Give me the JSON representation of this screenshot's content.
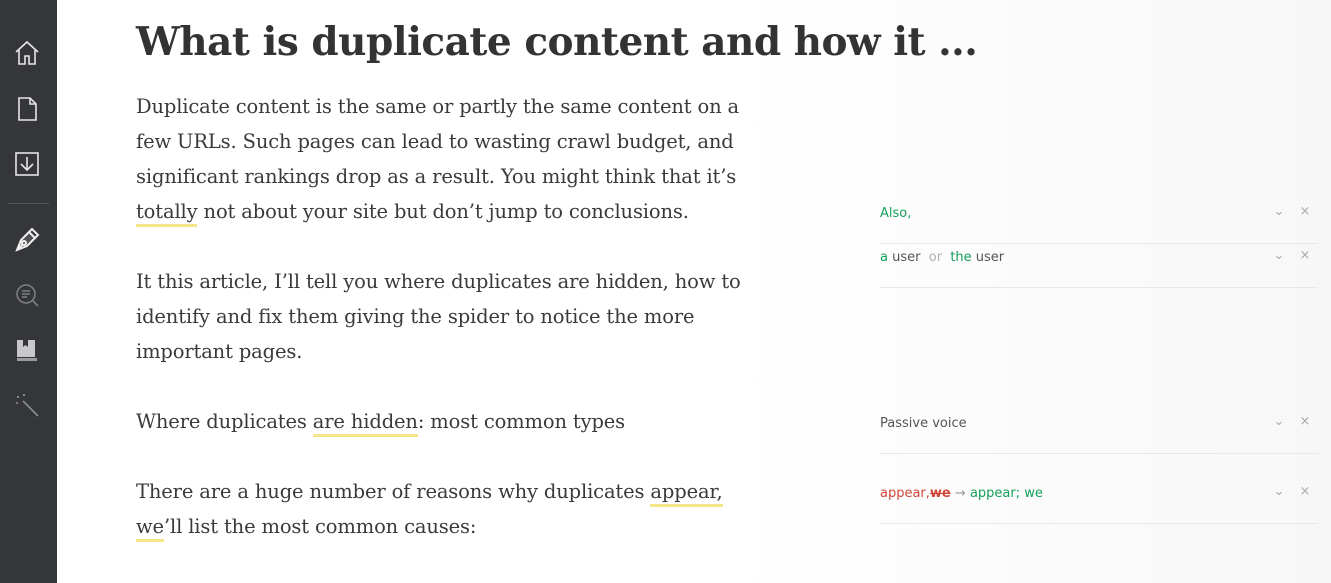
{
  "sidebar": {
    "icons": [
      "home-icon",
      "document-icon",
      "download-icon",
      "pen-icon",
      "search-doc-icon",
      "book-icon",
      "magic-wand-icon"
    ]
  },
  "document": {
    "title": "What is duplicate content and how it ...",
    "p1": {
      "before": "Duplicate content is the same or partly the same content on a few URLs. Such pages can lead to wasting crawl budget, and significant rankings drop as a result. You might think that it’s ",
      "flag": "totally",
      "after": " not about your site but don’t jump to conclusions."
    },
    "p2": "It this article, I’ll tell you where duplicates are hidden, how to identify and fix them giving the spider to notice the more important pages.",
    "p3": {
      "before": "Where duplicates ",
      "flag": "are hidden",
      "after": ": most common types"
    },
    "p4": {
      "before": "There are a huge  number of reasons why duplicates ",
      "flag1": "appear,",
      "middle": " ",
      "flag2": "we",
      "after": "’ll list the most common causes:"
    }
  },
  "suggestions": [
    {
      "id": "also",
      "text": "Also,",
      "color": "#15a05a"
    },
    {
      "id": "article",
      "a": "a",
      "user1": "user",
      "or": "or",
      "the": "the",
      "user2": "user"
    },
    {
      "id": "passive",
      "text": "Passive voice"
    },
    {
      "id": "punct",
      "old": "appear,",
      "oldwe": "we",
      "arrow": "→",
      "new": "appear; we"
    }
  ],
  "controls": {
    "expand": "⌄",
    "dismiss": "×"
  },
  "colors": {
    "sidebar": "#35363a",
    "accent_green": "#15a05a",
    "accent_red": "#d2463a",
    "highlight": "#f5e58a"
  }
}
